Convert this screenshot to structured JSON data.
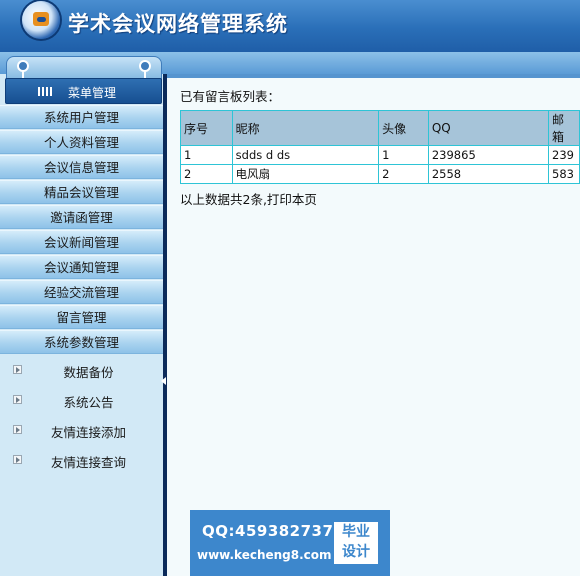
{
  "app": {
    "title": "学术会议网络管理系统"
  },
  "sidebar": {
    "menu_header": "菜单管理",
    "items": [
      {
        "label": "系统用户管理"
      },
      {
        "label": "个人资料管理"
      },
      {
        "label": "会议信息管理"
      },
      {
        "label": "精品会议管理"
      },
      {
        "label": "邀请函管理"
      },
      {
        "label": "会议新闻管理"
      },
      {
        "label": "会议通知管理"
      },
      {
        "label": "经验交流管理"
      },
      {
        "label": "留言管理"
      },
      {
        "label": "系统参数管理"
      }
    ],
    "sub_items": [
      {
        "label": "数据备份",
        "icon": "expand-arrow-icon"
      },
      {
        "label": "系统公告",
        "icon": "expand-arrow-icon"
      },
      {
        "label": "友情连接添加",
        "icon": "expand-arrow-icon"
      },
      {
        "label": "友情连接查询",
        "icon": "expand-arrow-icon"
      }
    ]
  },
  "main": {
    "heading": "已有留言板列表：",
    "table": {
      "columns": [
        "序号",
        "昵称",
        "头像",
        "QQ",
        "邮箱"
      ],
      "rows": [
        [
          "1",
          "sdds d ds",
          "1",
          "239865",
          "239"
        ],
        [
          "2",
          "电风扇",
          "2",
          "2558",
          "583"
        ]
      ]
    },
    "summary": "以上数据共2条,打印本页"
  },
  "watermark": {
    "qq": "QQ:459382737",
    "url": "www.kecheng8.com",
    "badge_line1": "毕业",
    "badge_line2": "设计"
  },
  "colors": {
    "header_blue": "#2a6fb8",
    "sidebar_bg": "#d2e9f6",
    "table_border": "#2ec4d6",
    "table_header_bg": "#a6c4d9",
    "watermark_blue": "#3d87cc"
  }
}
